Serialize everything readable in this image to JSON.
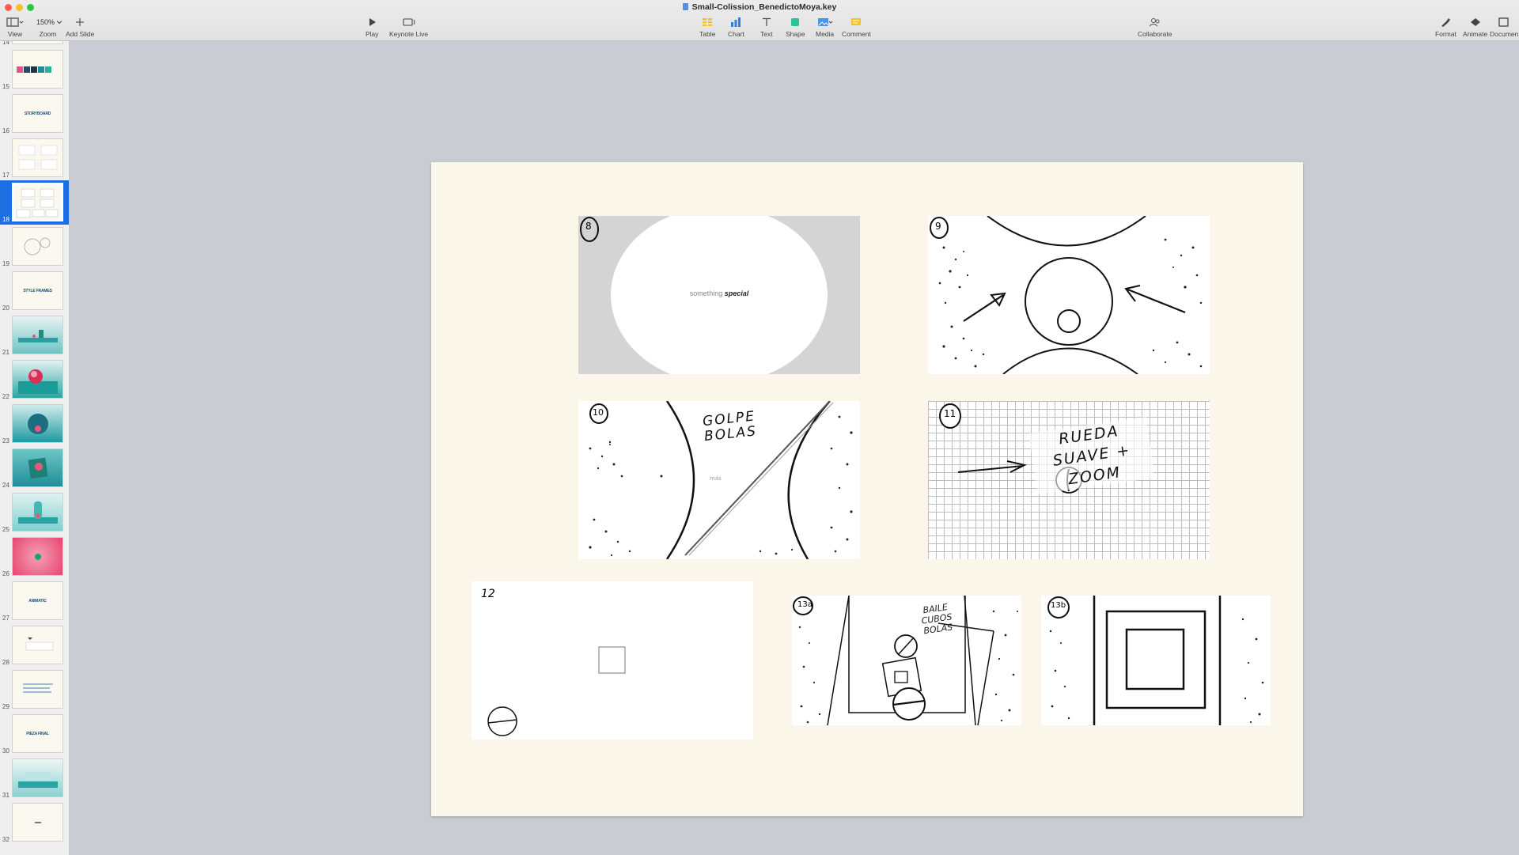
{
  "window": {
    "title": "Small-Colission_BenedictoMoya.key"
  },
  "toolbar": {
    "view_label": "View",
    "zoom_value": "150%",
    "zoom_label": "Zoom",
    "add_slide_label": "Add Slide",
    "play_label": "Play",
    "keynote_live_label": "Keynote Live",
    "table_label": "Table",
    "chart_label": "Chart",
    "text_label": "Text",
    "shape_label": "Shape",
    "media_label": "Media",
    "comment_label": "Comment",
    "collaborate_label": "Collaborate",
    "format_label": "Format",
    "animate_label": "Animate",
    "document_label": "Documen"
  },
  "sidebar": {
    "selected_slide": "18",
    "slides": [
      {
        "num": "14",
        "label": ""
      },
      {
        "num": "15",
        "label": ""
      },
      {
        "num": "16",
        "label": "STORYBOARD"
      },
      {
        "num": "17",
        "label": ""
      },
      {
        "num": "18",
        "label": ""
      },
      {
        "num": "19",
        "label": ""
      },
      {
        "num": "20",
        "label": "STYLE FRAMES"
      },
      {
        "num": "21",
        "label": ""
      },
      {
        "num": "22",
        "label": ""
      },
      {
        "num": "23",
        "label": ""
      },
      {
        "num": "24",
        "label": ""
      },
      {
        "num": "25",
        "label": ""
      },
      {
        "num": "26",
        "label": ""
      },
      {
        "num": "27",
        "label": "ANIMATIC"
      },
      {
        "num": "28",
        "label": ""
      },
      {
        "num": "29",
        "label": ""
      },
      {
        "num": "30",
        "label": "PIEZA FINAL"
      },
      {
        "num": "31",
        "label": ""
      },
      {
        "num": "32",
        "label": ""
      }
    ]
  },
  "slide": {
    "frames": [
      {
        "id": "8",
        "label": "8",
        "caption_a": "something",
        "caption_b": "special"
      },
      {
        "id": "9",
        "label": "9"
      },
      {
        "id": "10",
        "label": "10",
        "caption": "GOLPE BOLAS",
        "small_caption": "más"
      },
      {
        "id": "11",
        "label": "11",
        "caption": "RUEDA SUAVE + ZOOM"
      },
      {
        "id": "12",
        "label": "12"
      },
      {
        "id": "13a",
        "label": "13a",
        "caption": "BAILE CUBOS BOLAS"
      },
      {
        "id": "13b",
        "label": "13b"
      }
    ]
  }
}
